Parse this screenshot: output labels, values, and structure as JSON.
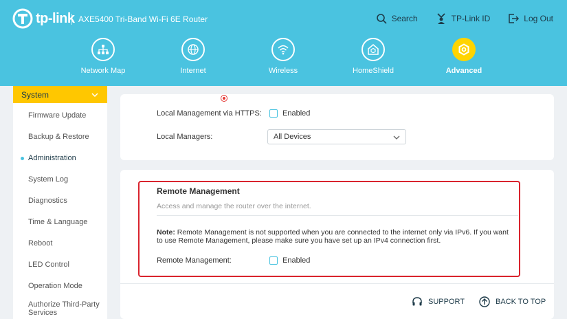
{
  "header": {
    "brand": "tp-link",
    "model": "AXE5400 Tri-Band Wi-Fi 6E Router",
    "actions": [
      {
        "label": "Search",
        "icon": "search-icon"
      },
      {
        "label": "TP-Link ID",
        "icon": "user-id-icon"
      },
      {
        "label": "Log Out",
        "icon": "logout-icon"
      }
    ],
    "nav": [
      {
        "label": "Network Map",
        "icon": "network-map-icon"
      },
      {
        "label": "Internet",
        "icon": "globe-icon"
      },
      {
        "label": "Wireless",
        "icon": "wifi-icon"
      },
      {
        "label": "HomeShield",
        "icon": "homeshield-icon"
      },
      {
        "label": "Advanced",
        "icon": "gear-icon",
        "active": true
      }
    ],
    "accent": "#ffd400",
    "background": "#4ac3e0"
  },
  "sidebar": {
    "section": "System",
    "items": [
      "Firmware Update",
      "Backup & Restore",
      "Administration",
      "System Log",
      "Diagnostics",
      "Time & Language",
      "Reboot",
      "LED Control",
      "Operation Mode",
      "Authorize Third-Party Services"
    ],
    "active_item": "Administration"
  },
  "local": {
    "https_label": "Local Management via HTTPS:",
    "https_checkbox_label": "Enabled",
    "https_checked": false,
    "managers_label": "Local Managers:",
    "managers_value": "All Devices"
  },
  "remote": {
    "title": "Remote Management",
    "subtitle": "Access and manage the router over the internet.",
    "note_prefix": "Note:",
    "note_text": " Remote Management is not supported when you are connected to the internet only via IPv6. If you want to use Remote Management, please make sure you have set up an IPv4 connection first.",
    "field_label": "Remote Management:",
    "checkbox_label": "Enabled",
    "checked": false,
    "highlight_color": "#d9232d"
  },
  "footer": {
    "support": "SUPPORT",
    "back_to_top": "BACK TO TOP"
  }
}
